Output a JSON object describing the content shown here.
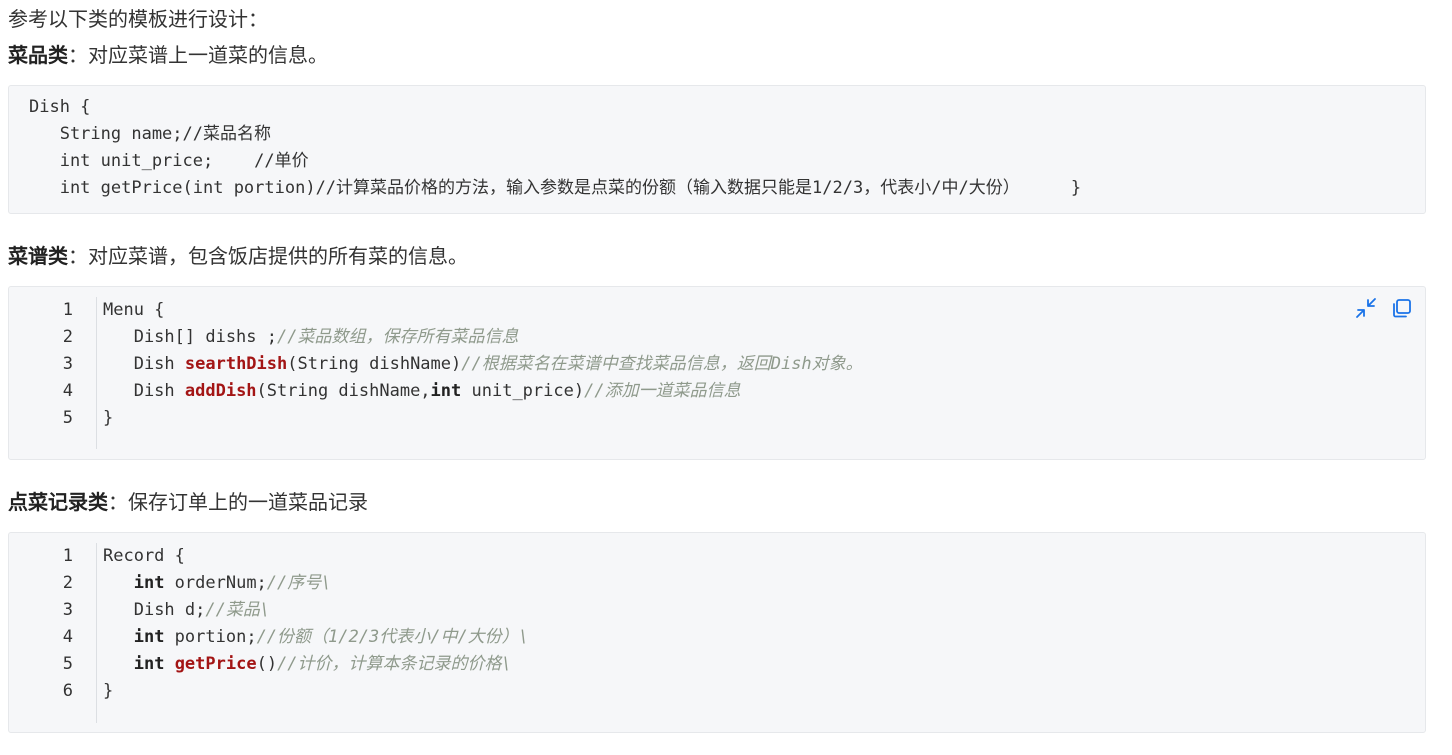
{
  "intro": "参考以下类的模板进行设计：",
  "dish_section": {
    "title": "菜品类",
    "desc": "：对应菜谱上一道菜的信息。",
    "code": [
      "Dish {",
      "   String name;//菜品名称",
      "   int unit_price;    //单价",
      "   int getPrice(int portion)//计算菜品价格的方法，输入参数是点菜的份额（输入数据只能是1/2/3，代表小/中/大份）     }"
    ]
  },
  "menu_section": {
    "title": "菜谱类",
    "desc": "：对应菜谱，包含饭店提供的所有菜的信息。",
    "line_numbers": [
      "1",
      "2",
      "3",
      "4",
      "5"
    ],
    "code": {
      "l1": "Menu {",
      "l2_code": "   Dish[] dishs ;",
      "l2_comment": "//菜品数组，保存所有菜品信息",
      "l3_pre": "   Dish ",
      "l3_fn": "searthDish",
      "l3_args": "(String dishName)",
      "l3_comment": "//根据菜名在菜谱中查找菜品信息，返回Dish对象。",
      "l4_pre": "   Dish ",
      "l4_fn": "addDish",
      "l4_args1": "(String dishName,",
      "l4_kw": "int",
      "l4_args2": " unit_price)",
      "l4_comment": "//添加一道菜品信息",
      "l5": "}"
    },
    "tools": {
      "collapse_icon": "collapse-icon",
      "copy_icon": "copy-icon",
      "accent": "#1a73e8"
    }
  },
  "record_section": {
    "title": "点菜记录类",
    "desc": "：保存订单上的一道菜品记录",
    "line_numbers": [
      "1",
      "2",
      "3",
      "4",
      "5",
      "6"
    ],
    "code": {
      "l1": "Record {",
      "l2_kw": "int",
      "l2_code": " orderNum;",
      "l2_comment": "//序号\\",
      "l3_code": "Dish d;",
      "l3_comment": "//菜品\\",
      "l4_kw": "int",
      "l4_code": " portion;",
      "l4_comment": "//份额（1/2/3代表小/中/大份）\\",
      "l5_kw": "int",
      "l5_fn": "getPrice",
      "l5_code": "()",
      "l5_comment": "//计价，计算本条记录的价格\\",
      "l6": "}"
    }
  }
}
